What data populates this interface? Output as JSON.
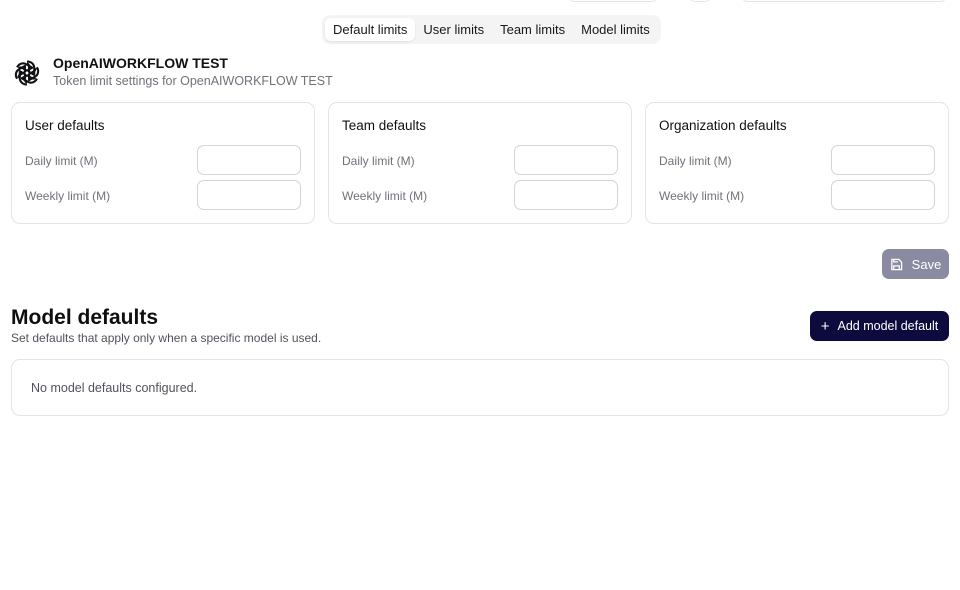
{
  "tabs": {
    "items": [
      {
        "label": "Default limits",
        "active": true
      },
      {
        "label": "User limits",
        "active": false
      },
      {
        "label": "Team limits",
        "active": false
      },
      {
        "label": "Model limits",
        "active": false
      }
    ]
  },
  "org": {
    "name": "OpenAIWORKFLOW TEST",
    "subtitle": "Token limit settings for OpenAIWORKFLOW TEST",
    "logo_icon": "openai-logo-icon"
  },
  "cards": [
    {
      "title": "User defaults",
      "daily_label": "Daily limit (M)",
      "weekly_label": "Weekly limit (M)",
      "daily_value": "",
      "weekly_value": ""
    },
    {
      "title": "Team defaults",
      "daily_label": "Daily limit (M)",
      "weekly_label": "Weekly limit (M)",
      "daily_value": "",
      "weekly_value": ""
    },
    {
      "title": "Organization defaults",
      "daily_label": "Daily limit (M)",
      "weekly_label": "Weekly limit (M)",
      "daily_value": "",
      "weekly_value": ""
    }
  ],
  "save": {
    "label": "Save",
    "icon": "save-icon",
    "color": "#8a8aa3"
  },
  "model_defaults": {
    "title": "Model defaults",
    "subtitle": "Set defaults that apply only when a specific model is used.",
    "add_button_label": "Add model default",
    "add_button_icon": "plus-icon",
    "add_button_color": "#0d0a3e",
    "empty_text": "No model defaults configured."
  }
}
